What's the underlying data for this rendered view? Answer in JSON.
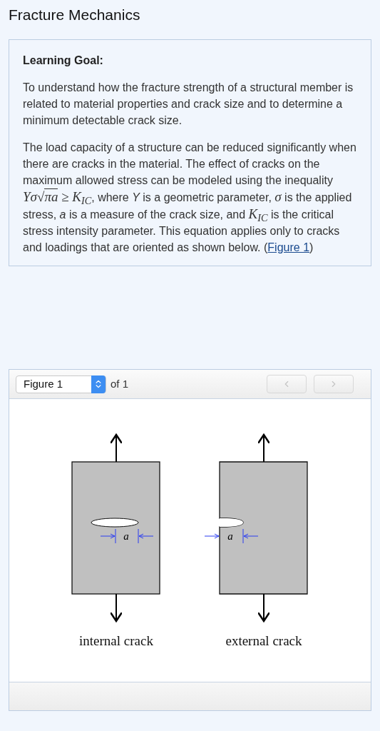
{
  "title": "Fracture Mechanics",
  "goal": {
    "heading": "Learning Goal:",
    "paragraphs": [
      [
        {
          "kind": "text",
          "text": "To understand how the fracture strength of a structural member is related to material properties and crack size and to determine a minimum detectable crack size."
        }
      ],
      [
        {
          "kind": "text",
          "text": "The load capacity of a structure can be reduced significantly when there are cracks in the material. The effect of cracks on the maximum allowed stress can be modeled using the inequality "
        },
        {
          "kind": "math",
          "text": "Yσ"
        },
        {
          "kind": "math",
          "text": "√"
        },
        {
          "kind": "radicand",
          "text": "πa"
        },
        {
          "kind": "math",
          "text": " ≥ K$_{IC}$"
        },
        {
          "kind": "text",
          "text": ", where *Y* is a geometric parameter, "
        },
        {
          "kind": "math",
          "text": "σ"
        },
        {
          "kind": "text",
          "text": " is the applied stress, *a* is a measure of the crack size, and "
        },
        {
          "kind": "math",
          "text": "K$_{IC}$"
        },
        {
          "kind": "text",
          "text": " is the critical stress intensity parameter. This equation applies only to cracks and loadings that are oriented as shown below. ("
        },
        {
          "kind": "link",
          "text": "Figure 1"
        },
        {
          "kind": "text",
          "text": ")"
        }
      ]
    ]
  },
  "figure_viewer": {
    "select_value": "Figure 1",
    "count": "of 1",
    "prev_disabled": true,
    "next_disabled": true,
    "figure": {
      "crack_labels": [
        "a",
        "a"
      ],
      "captions": [
        "internal crack",
        "external crack"
      ]
    }
  }
}
